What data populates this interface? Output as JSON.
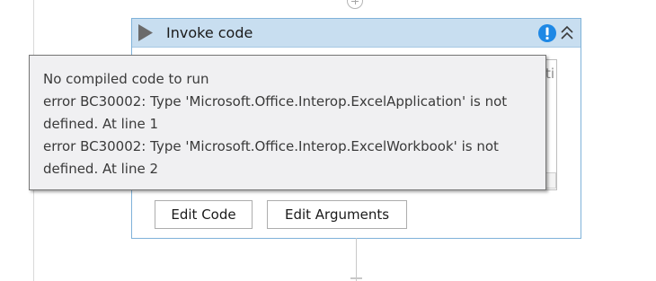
{
  "activity": {
    "title": "Invoke code",
    "icons": {
      "play": "play-triangle-icon",
      "warning": "exclamation-warning-icon",
      "collapse": "double-chevron-up-icon"
    },
    "code_preview_fragment": "ti"
  },
  "buttons": {
    "edit_code": "Edit Code",
    "edit_arguments": "Edit Arguments"
  },
  "tooltip": {
    "lines": [
      "No compiled code to run",
      "error BC30002: Type 'Microsoft.Office.Interop.ExcelApplication' is not",
      "defined. At line 1",
      "error BC30002: Type 'Microsoft.Office.Interop.ExcelWorkbook' is not",
      "defined. At line 2"
    ]
  },
  "colors": {
    "header_bg": "#c8def0",
    "border_accent": "#7fb2d9",
    "warning_blue": "#1e88e5",
    "play_gray": "#6b6b6b"
  }
}
